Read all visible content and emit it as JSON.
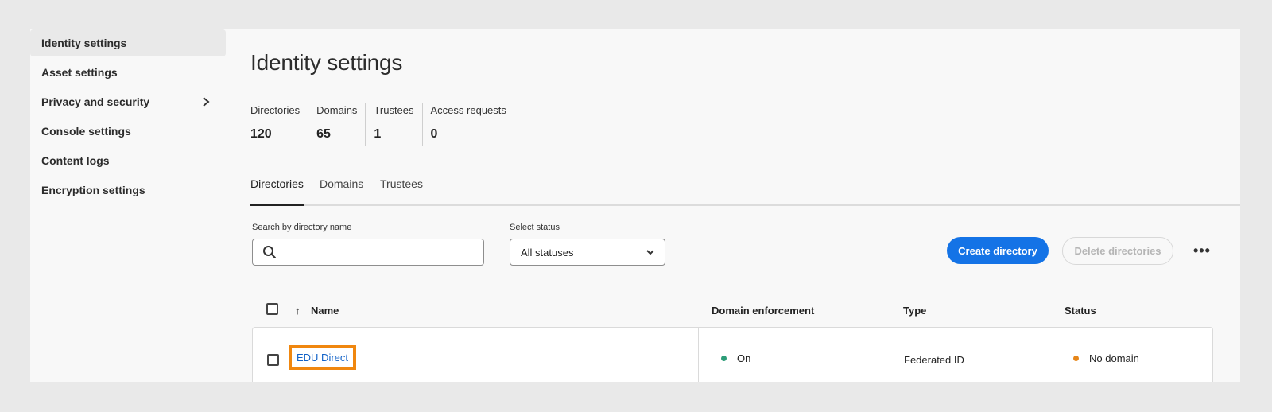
{
  "sidebar": {
    "items": [
      {
        "label": "Identity settings",
        "active": true
      },
      {
        "label": "Asset settings"
      },
      {
        "label": "Privacy and security",
        "chevron": ">"
      },
      {
        "label": "Console settings"
      },
      {
        "label": "Content logs"
      },
      {
        "label": "Encryption settings"
      }
    ]
  },
  "page": {
    "title": "Identity settings",
    "stats": [
      {
        "label": "Directories",
        "value": "120"
      },
      {
        "label": "Domains",
        "value": "65"
      },
      {
        "label": "Trustees",
        "value": "1"
      },
      {
        "label": "Access requests",
        "value": "0"
      }
    ],
    "tabs": [
      {
        "label": "Directories",
        "active": true
      },
      {
        "label": "Domains"
      },
      {
        "label": "Trustees"
      }
    ]
  },
  "filters": {
    "search_label": "Search by directory name",
    "search_value": "",
    "status_label": "Select status",
    "status_value": "All statuses"
  },
  "actions": {
    "create": "Create directory",
    "delete": "Delete directories",
    "more": "•••"
  },
  "table": {
    "sort_arrow": "↑",
    "headers": {
      "name": "Name",
      "domain_enforcement": "Domain enforcement",
      "type": "Type",
      "status": "Status"
    },
    "rows": [
      {
        "name": "EDU Direct",
        "domain_enforcement": "On",
        "type": "Federated ID",
        "status": "No domain"
      }
    ]
  },
  "colors": {
    "accent": "#1473e6",
    "link": "#1162c8",
    "highlight": "#f0870f",
    "status_on": "#2d9d78",
    "status_warning": "#e68619"
  }
}
